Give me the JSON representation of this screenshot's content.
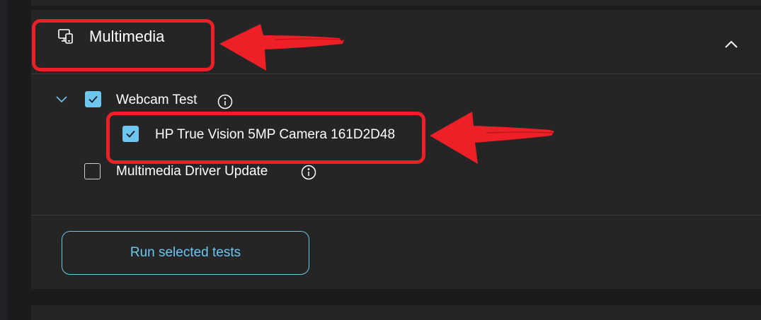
{
  "section": {
    "title": "Multimedia",
    "icon": "monitor-devices-icon"
  },
  "tests": [
    {
      "label": "Webcam Test",
      "checked": true,
      "expanded": true
    },
    {
      "label": "HP True Vision 5MP Camera 161D2D48",
      "checked": true
    },
    {
      "label": "Multimedia Driver Update",
      "checked": false
    }
  ],
  "run_button": {
    "label": "Run selected tests"
  },
  "colors": {
    "accent": "#6cc6f0",
    "panel": "#252525",
    "background": "#1b1b1d",
    "annotation": "#ee2027"
  }
}
